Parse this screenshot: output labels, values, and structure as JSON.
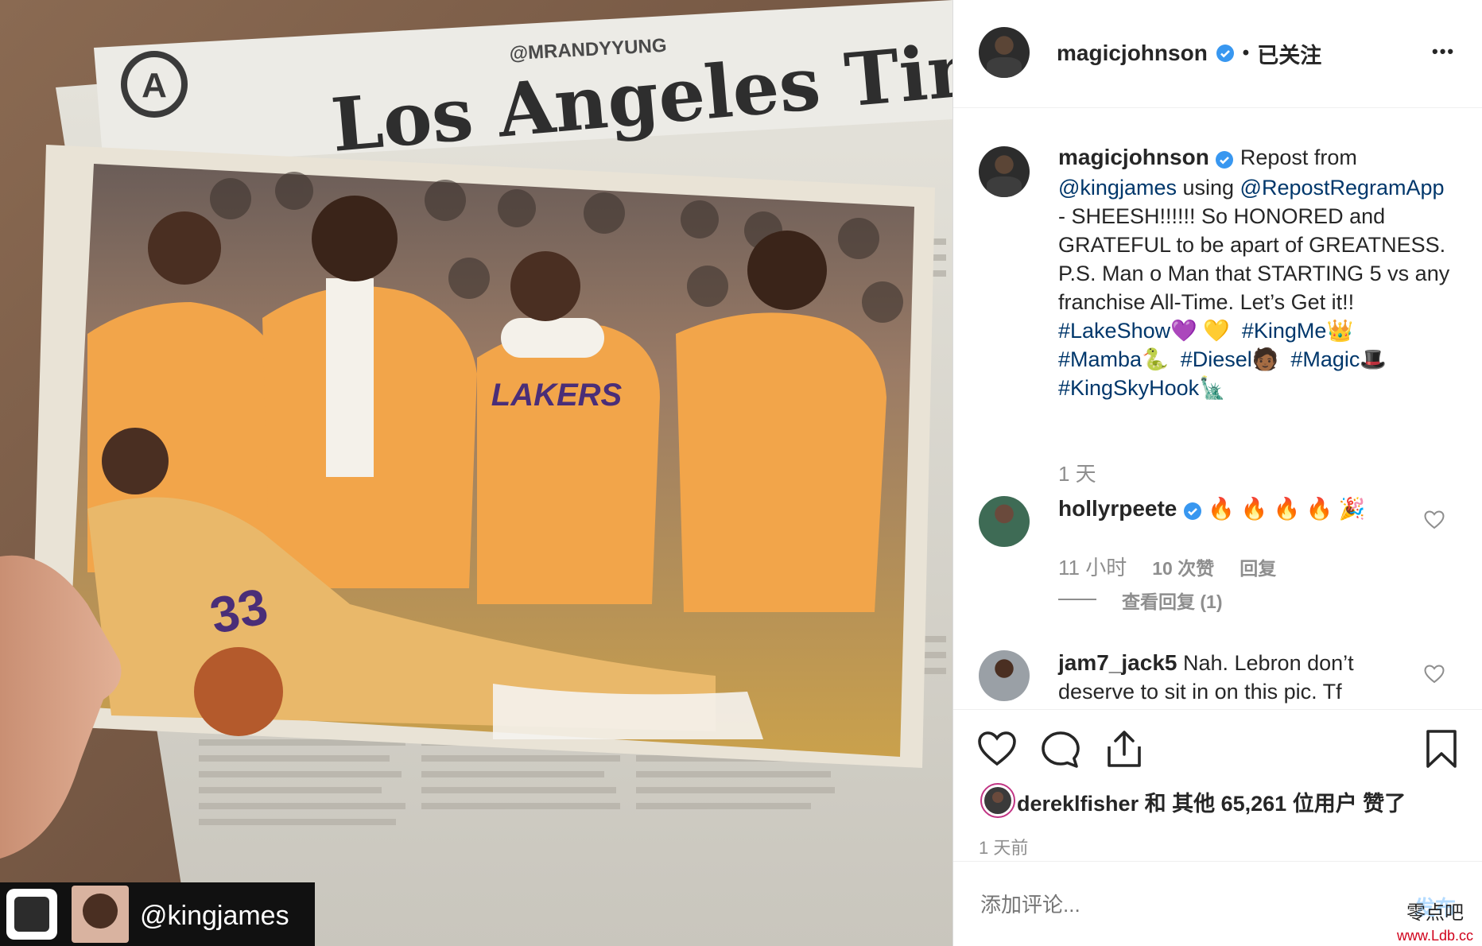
{
  "post": {
    "watermark_handle": "@MRANDYYUNG",
    "newspaper_title": "Los Angeles Times",
    "jersey_text": "LAKERS",
    "jersey_number": "33",
    "repost_handle": "@kingjames"
  },
  "header": {
    "username": "magicjohnson",
    "separator": "•",
    "follow_status": "已关注",
    "more_label": "•••"
  },
  "caption": {
    "username": "magicjohnson",
    "text_1": " Repost from ",
    "mention_1": "@kingjames",
    "text_2": " using ",
    "mention_2": "@RepostRegramApp",
    "text_3": " - SHEESH!!!!!! So HONORED and GRATEFUL to be apart of GREATNESS. P.S. Man o Man that STARTING 5 vs any franchise All-Time. Let’s Get it!! ",
    "tags": [
      {
        "tag": "#LakeShow",
        "emoji": "💜 💛"
      },
      {
        "tag": "#KingMe",
        "emoji": "👑"
      },
      {
        "tag": "#Mamba",
        "emoji": "🐍"
      },
      {
        "tag": "#Diesel",
        "emoji": "🧑🏾"
      },
      {
        "tag": "#Magic",
        "emoji": "🎩"
      },
      {
        "tag": "#KingSkyHook",
        "emoji": "🗽"
      }
    ],
    "time": "1 天"
  },
  "comments": [
    {
      "username": "hollyrpeete",
      "text": "🔥 🔥 🔥 🔥 🎉",
      "time": "11 小时",
      "likes": "10 次赞",
      "reply": "回复",
      "view_replies": "查看回复 (1)"
    },
    {
      "username": "jam7_jack5",
      "text": "Nah. Lebron don’t deserve to sit in on this pic. Tf"
    }
  ],
  "likes": {
    "liker": "dereklfisher",
    "connector": "和",
    "others": "其他 65,261 位用户",
    "suffix": "赞了"
  },
  "post_time": "1 天前",
  "add_comment": {
    "placeholder": "添加评论...",
    "post_label": "发布"
  },
  "site_watermark": {
    "line1": "零点吧",
    "line2": "www.Ldb.cc"
  },
  "colors": {
    "link": "#00376b",
    "verified": "#3897f0",
    "muted": "#8e8e8e",
    "post_button": "#b3dbff",
    "watermark_red": "#d0021b"
  }
}
